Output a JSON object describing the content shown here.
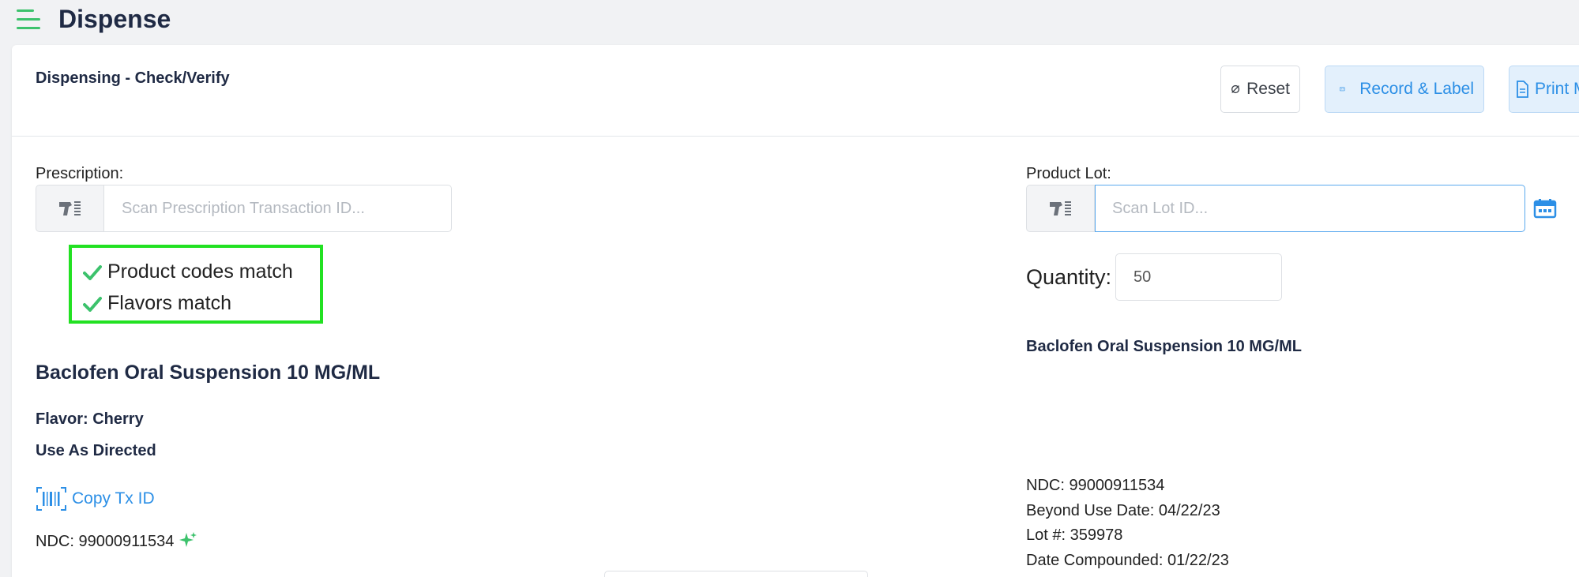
{
  "app": {
    "title": "Dispense",
    "menu_icon": "hamburger-menu-icon"
  },
  "card": {
    "title": "Dispensing - Check/Verify",
    "buttons": {
      "reset": "Reset",
      "record_label": "Record & Label",
      "print": "Print M"
    }
  },
  "prescription": {
    "label": "Prescription:",
    "placeholder": "Scan Prescription Transaction ID...",
    "checks": [
      "Product codes match",
      "Flavors match"
    ],
    "drug_name": "Baclofen Oral Suspension 10 MG/ML",
    "flavor": "Flavor: Cherry",
    "directions": "Use As Directed",
    "copy_link": "Copy Tx ID",
    "ndc": "NDC: 99000911534"
  },
  "product_lot": {
    "label": "Product Lot:",
    "placeholder": "Scan Lot ID...",
    "quantity_label": "Quantity:",
    "quantity_value": "50",
    "drug_name": "Baclofen Oral Suspension 10 MG/ML",
    "ndc": "NDC: 99000911534",
    "beyond_use_date": "Beyond Use Date: 04/22/23",
    "lot_number": "Lot #: 359978",
    "date_compounded": "Date Compounded: 01/22/23"
  },
  "colors": {
    "accent_blue": "#2c8fe6",
    "success_green": "#3cc26c",
    "highlight_box": "#22e122",
    "text_dark": "#1f2a44"
  }
}
